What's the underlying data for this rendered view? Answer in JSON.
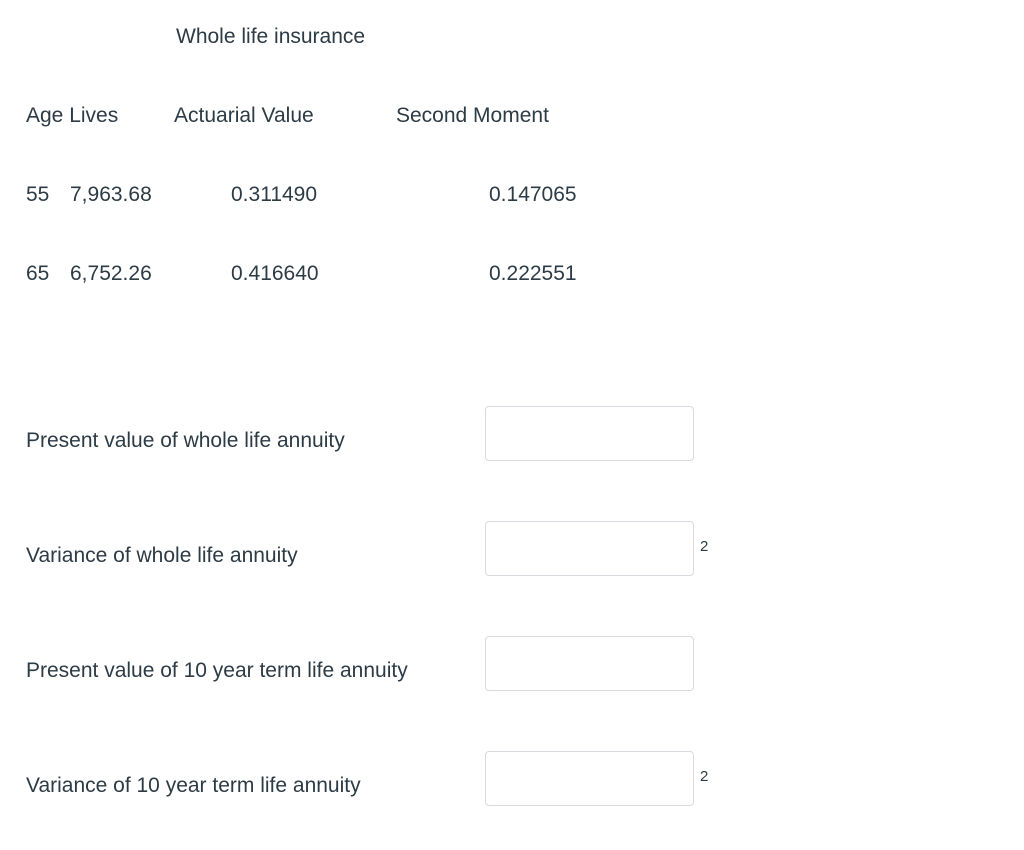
{
  "document": {
    "title": "Whole life insurance"
  },
  "table": {
    "columns": [
      {
        "key": "age_lives",
        "label": "Age Lives"
      },
      {
        "key": "actuarial_value",
        "label": "Actuarial Value"
      },
      {
        "key": "second_moment",
        "label": "Second Moment"
      }
    ],
    "rows": [
      {
        "age": "55",
        "lives": "7,963.68",
        "actuarial_value": "0.311490",
        "second_moment": "0.147065"
      },
      {
        "age": "65",
        "lives": "6,752.26",
        "actuarial_value": "0.416640",
        "second_moment": "0.222551"
      }
    ]
  },
  "form": {
    "fields": [
      {
        "label": "Present value of whole life annuity",
        "value": "",
        "placeholder": "",
        "superscript": ""
      },
      {
        "label": "Variance of whole life annuity",
        "value": "",
        "placeholder": "",
        "superscript": "2"
      },
      {
        "label": "Present value of 10 year term life annuity",
        "value": "",
        "placeholder": "",
        "superscript": ""
      },
      {
        "label": "Variance of 10 year term life annuity",
        "value": "",
        "placeholder": "",
        "superscript": "2"
      }
    ]
  },
  "colors": {
    "text": "#2d3b45",
    "input_border": "#d7dade",
    "background": "#ffffff"
  }
}
